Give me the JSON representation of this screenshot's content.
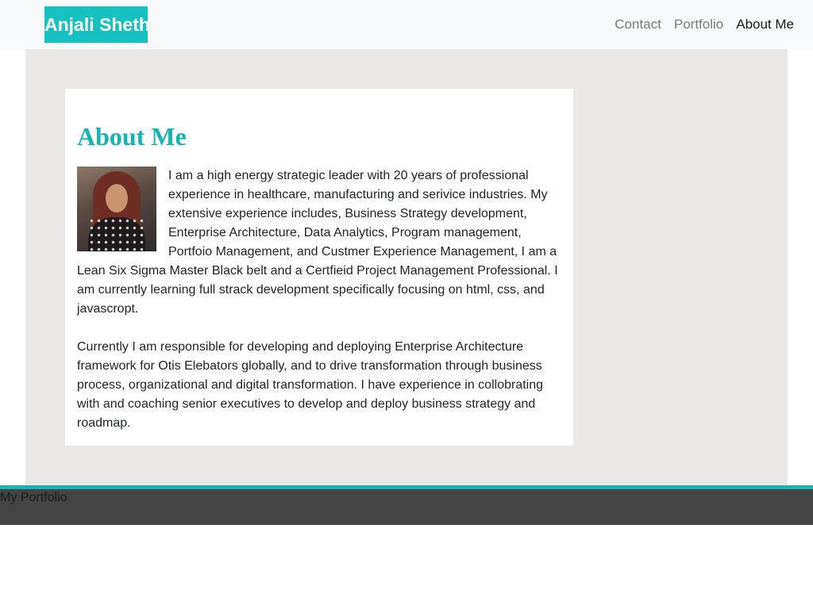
{
  "navbar": {
    "brand": "Anjali Sheth",
    "links": [
      {
        "label": "Contact"
      },
      {
        "label": "Portfolio"
      },
      {
        "label": "About Me"
      }
    ],
    "active": "About Me"
  },
  "about": {
    "heading": "About Me",
    "paragraphs": [
      "I am a high energy strategic leader with 20 years of professional experience in healthcare, manufacturing and serivice industries. My extensive experience includes, Business Strategy development, Enterprise Architecture, Data Analytics, Program management, Portfoio Management, and Custmer Experience Management, I am a Lean Six Sigma Master Black belt and a Certfieid Project Management Professional. I am currently learning full strack development specifically focusing on html, css, and javascropt.",
      "Currently I am responsible for developing and deploying Enterprise Architecture framework for Otis Elebators globally, and to drive transformation through business process, organizational and digital transformation. I have experience in collobrating with and coaching senior executives to develop and deploy business strategy and roadmap."
    ]
  },
  "footer": {
    "text": "My Portfolio"
  },
  "colors": {
    "accent": "#17c1c1",
    "heading": "#17b3b3",
    "main_bg": "#e9e8e6",
    "footer_bg": "#444444"
  }
}
